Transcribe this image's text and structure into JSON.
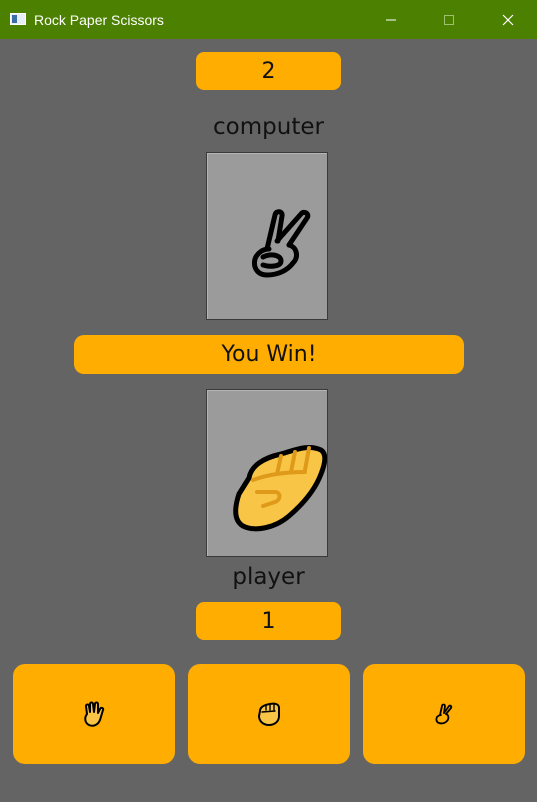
{
  "window": {
    "title": "Rock Paper Scissors"
  },
  "colors": {
    "titlebar": "#4c8000",
    "background": "#646464",
    "accent": "#ffad00",
    "card": "#9b9b9b"
  },
  "computer": {
    "score": "2",
    "label": "computer",
    "choice_icon": "scissors-hand-icon"
  },
  "result": {
    "text": "You Win!"
  },
  "player": {
    "score": "1",
    "label": "player",
    "choice_icon": "rock-fist-icon"
  },
  "choices": [
    {
      "name": "paper",
      "icon": "paper-hand-icon"
    },
    {
      "name": "rock",
      "icon": "rock-fist-icon"
    },
    {
      "name": "scissors",
      "icon": "scissors-hand-icon"
    }
  ]
}
